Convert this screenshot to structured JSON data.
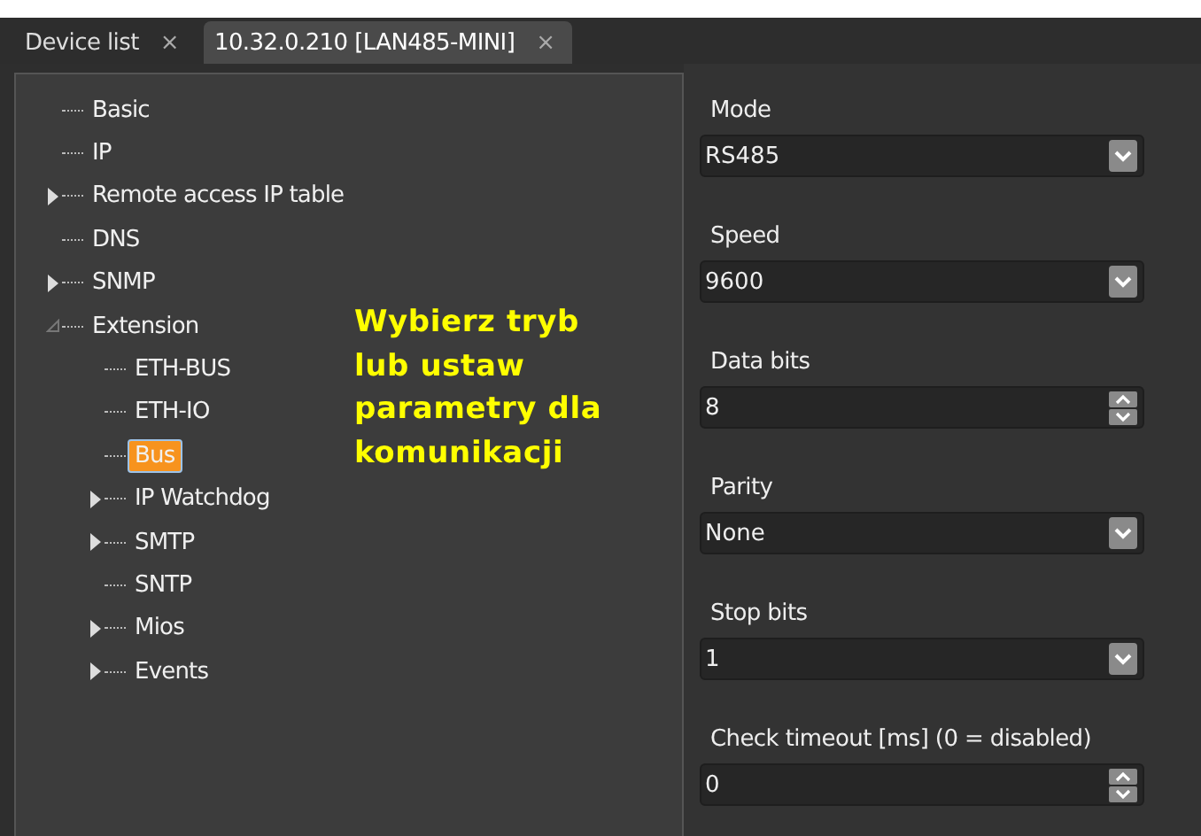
{
  "tabs": [
    {
      "label": "Device list",
      "close": "×",
      "selected": false
    },
    {
      "label": "10.32.0.210 [LAN485-MINI]",
      "close": "×",
      "selected": true
    }
  ],
  "tree": [
    {
      "label": "Basic",
      "selected": false
    },
    {
      "label": "IP",
      "selected": false
    },
    {
      "label": "Remote access IP table",
      "selected": false,
      "expanded": false
    },
    {
      "label": "DNS",
      "selected": false
    },
    {
      "label": "SNMP",
      "selected": false,
      "expanded": false
    },
    {
      "label": "Extension",
      "selected": false,
      "expanded": true,
      "children": [
        {
          "label": "ETH-BUS",
          "selected": false
        },
        {
          "label": "ETH-IO",
          "selected": false
        },
        {
          "label": "Bus",
          "selected": true
        },
        {
          "label": "IP Watchdog",
          "selected": false,
          "expanded": false
        },
        {
          "label": "SMTP",
          "selected": false,
          "expanded": false
        },
        {
          "label": "SNTP",
          "selected": false
        },
        {
          "label": "Mios",
          "selected": false,
          "expanded": false
        },
        {
          "label": "Events",
          "selected": false,
          "expanded": false
        }
      ]
    }
  ],
  "annotation": "Wybierz tryb\nlub ustaw\nparametry dla\nkomunikacji",
  "fields": [
    {
      "label": "Mode",
      "kind": "select",
      "value": "RS485"
    },
    {
      "label": "Speed",
      "kind": "select",
      "value": "9600"
    },
    {
      "label": "Data bits",
      "kind": "spin",
      "value": "8"
    },
    {
      "label": "Parity",
      "kind": "select",
      "value": "None"
    },
    {
      "label": "Stop bits",
      "kind": "select",
      "value": "1"
    },
    {
      "label": "Check timeout [ms] (0 = disabled)",
      "kind": "spin",
      "value": "0"
    }
  ]
}
